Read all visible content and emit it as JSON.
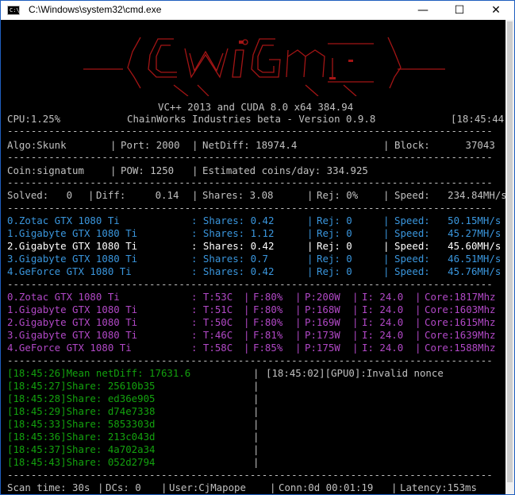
{
  "window": {
    "title": "C:\\Windows\\system32\\cmd.exe",
    "icon_label": "C:\\",
    "minimize_label": "—",
    "maximize_label": "☐",
    "close_label": "✕"
  },
  "banner": {
    "subtitle1": "VC++ 2013 and CUDA 8.0 x64 384.94",
    "subtitle2": "ChainWorks Industries beta - Version 0.9.8",
    "logo_color": "#a31515"
  },
  "header": {
    "cpu": "CPU:1.25%",
    "time": "[18:45:44]"
  },
  "stats": {
    "algo": "Algo:Skunk",
    "port": "Port: 2000",
    "netdiff": "NetDiff: 18974.4",
    "block": "Block:      37043",
    "coin": "Coin:signatum",
    "pow": "POW: 1250",
    "estimated": "Estimated coins/day: 334.925",
    "solved": "Solved:   0",
    "diff": "Diff:     0.14",
    "shares": "Shares: 3.08",
    "rej": "Rej: 0%",
    "speed": "Speed:   234.84MH/s"
  },
  "gpus": [
    {
      "name": "0.Zotac GTX 1080 Ti",
      "shares": ": Shares: 0.42",
      "rej": "Rej: 0",
      "speed": "Speed:   50.15MH/s",
      "temp": ": T:53C",
      "fan": "F:80%",
      "power": "P:200W",
      "intensity": "I: 24.0",
      "core": "Core:1817Mhz"
    },
    {
      "name": "1.Gigabyte GTX 1080 Ti",
      "shares": ": Shares: 1.12",
      "rej": "Rej: 0",
      "speed": "Speed:   45.27MH/s",
      "temp": ": T:51C",
      "fan": "F:80%",
      "power": "P:168W",
      "intensity": "I: 24.0",
      "core": "Core:1603Mhz"
    },
    {
      "name": "2.Gigabyte GTX 1080 Ti",
      "shares": ": Shares: 0.42",
      "rej": "Rej: 0",
      "speed": "Speed:   45.60MH/s",
      "temp": ": T:50C",
      "fan": "F:80%",
      "power": "P:169W",
      "intensity": "I: 24.0",
      "core": "Core:1615Mhz"
    },
    {
      "name": "3.Gigabyte GTX 1080 Ti",
      "shares": ": Shares: 0.7",
      "rej": "Rej: 0",
      "speed": "Speed:   46.51MH/s",
      "temp": ": T:46C",
      "fan": "F:81%",
      "power": "P:173W",
      "intensity": "I: 24.0",
      "core": "Core:1639Mhz"
    },
    {
      "name": "4.GeForce GTX 1080 Ti",
      "shares": ": Shares: 0.42",
      "rej": "Rej: 0",
      "speed": "Speed:   45.76MH/s",
      "temp": ": T:58C",
      "fan": "F:85%",
      "power": "P:175W",
      "intensity": "I: 24.0",
      "core": "Core:1588Mhz"
    }
  ],
  "log": [
    "[18:45:26]Mean netDiff: 17631.6",
    "[18:45:27]Share: 25610b35",
    "[18:45:28]Share: ed36e905",
    "[18:45:29]Share: d74e7338",
    "[18:45:33]Share: 5853303d",
    "[18:45:36]Share: 213c043d",
    "[18:45:37]Share: 4a702a34",
    "[18:45:43]Share: 052d2794"
  ],
  "event_log": "[18:45:02][GPU0]:Invalid nonce",
  "footer": {
    "scan": "Scan time: 30s",
    "dcs": "DCs: 0",
    "user": "User:CjMapope",
    "conn": "Conn:0d 00:01:19",
    "latency": "Latency:153ms"
  }
}
